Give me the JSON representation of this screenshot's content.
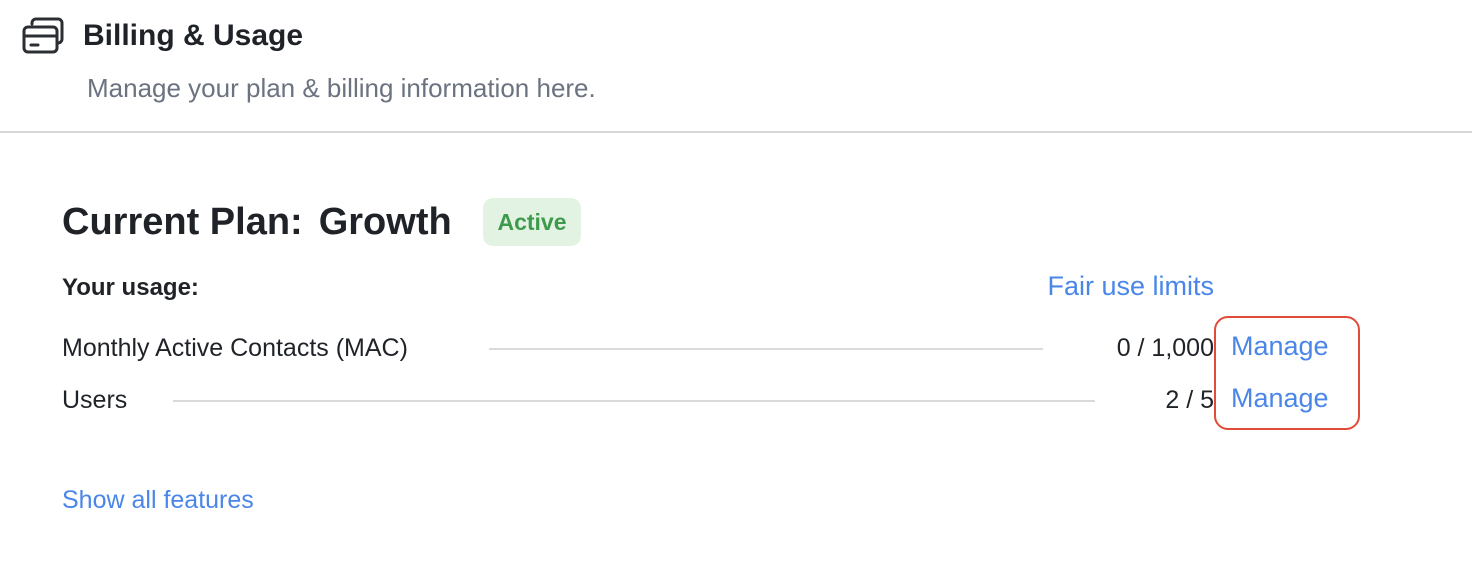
{
  "header": {
    "icon": "credit-card-stack-icon",
    "title": "Billing & Usage",
    "subtitle": "Manage your plan & billing information here."
  },
  "plan": {
    "label": "Current Plan:",
    "name": "Growth",
    "status": "Active",
    "status_color": "#3e9a4c",
    "status_bg": "#e3f3e3"
  },
  "usage": {
    "title": "Your usage:",
    "fair_use_link": "Fair use limits",
    "rows": [
      {
        "name": "Monthly Active Contacts (MAC)",
        "value": "0 / 1,000",
        "action": "Manage"
      },
      {
        "name": "Users",
        "value": "2 / 5",
        "action": "Manage"
      }
    ]
  },
  "show_all_features": "Show all features",
  "colors": {
    "link": "#4a86e8",
    "highlight": "#e04b3a",
    "text": "#1f2328",
    "muted": "#6b7280"
  }
}
